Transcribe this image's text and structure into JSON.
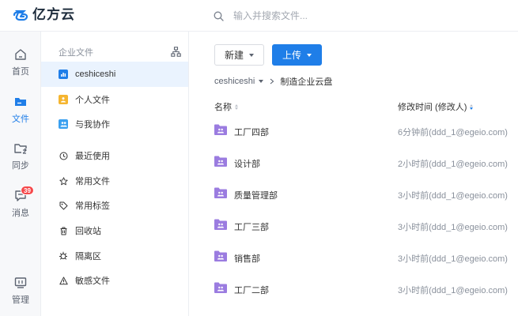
{
  "app": {
    "logo_text": "亿方云",
    "brand_color": "#1f7ee8"
  },
  "search": {
    "placeholder": "输入并搜索文件..."
  },
  "leftnav": {
    "items": [
      {
        "label": "首页",
        "icon": "home-icon"
      },
      {
        "label": "文件",
        "icon": "folder-icon",
        "active": true
      },
      {
        "label": "同步",
        "icon": "sync-folder-icon"
      },
      {
        "label": "消息",
        "icon": "message-icon",
        "badge": "39"
      },
      {
        "label": "管理",
        "icon": "admin-monitor-icon"
      }
    ]
  },
  "sidebar": {
    "header": "企业文件",
    "items": [
      {
        "label": "ceshiceshi",
        "icon": "enterprise-space-icon",
        "icon_color": "#1f7ee8",
        "selected": true
      },
      {
        "label": "个人文件",
        "icon": "personal-files-icon",
        "icon_color": "#f5b530"
      },
      {
        "label": "与我协作",
        "icon": "collaboration-icon",
        "icon_color": "#3aa0f0"
      },
      {
        "label": "最近使用",
        "icon": "clock-icon"
      },
      {
        "label": "常用文件",
        "icon": "star-icon"
      },
      {
        "label": "常用标签",
        "icon": "tag-icon"
      },
      {
        "label": "回收站",
        "icon": "trash-icon"
      },
      {
        "label": "隔离区",
        "icon": "virus-icon"
      },
      {
        "label": "敏感文件",
        "icon": "warning-icon"
      }
    ]
  },
  "toolbar": {
    "new_label": "新建",
    "upload_label": "上传"
  },
  "breadcrumb": {
    "root": "ceshiceshi",
    "current": "制造企业云盘"
  },
  "table": {
    "col_name": "名称",
    "col_modified": "修改时间 (修改人)",
    "rows": [
      {
        "name": "工厂四部",
        "modified": "6分钟前(ddd_1@egeio.com)"
      },
      {
        "name": "设计部",
        "modified": "2小时前(ddd_1@egeio.com)"
      },
      {
        "name": "质量管理部",
        "modified": "3小时前(ddd_1@egeio.com)"
      },
      {
        "name": "工厂三部",
        "modified": "3小时前(ddd_1@egeio.com)"
      },
      {
        "name": "销售部",
        "modified": "3小时前(ddd_1@egeio.com)"
      },
      {
        "name": "工厂二部",
        "modified": "3小时前(ddd_1@egeio.com)"
      }
    ]
  },
  "colors": {
    "folder": "#9b7ce0",
    "accent": "#1f7ee8",
    "badge": "#f5484b"
  }
}
